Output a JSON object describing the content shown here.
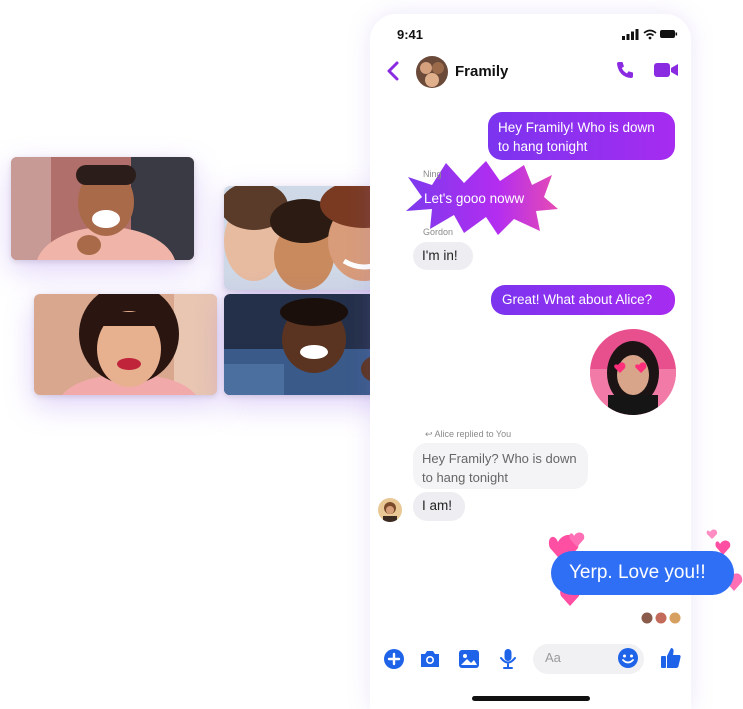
{
  "status_bar": {
    "time": "9:41"
  },
  "header": {
    "title": "Framily",
    "back_icon": "chevron-left-icon",
    "call_icon": "phone-icon",
    "video_icon": "video-camera-icon",
    "accent": "#8a2be2"
  },
  "video_call": {
    "tiles": [
      {
        "description": "participant-1"
      },
      {
        "description": "participant-2-group"
      },
      {
        "description": "participant-3"
      },
      {
        "description": "participant-4"
      }
    ]
  },
  "messages": {
    "m1": {
      "text": "Hey Framily! Who is down to hang tonight"
    },
    "m2": {
      "sender": "Ning",
      "text": "Let's gooo noww"
    },
    "m3": {
      "sender": "Gordon",
      "text": "I'm in!"
    },
    "m4": {
      "text": "Great! What about Alice?"
    },
    "reply_label": "Alice replied to You",
    "quoted": "Hey Framily? Who is down to hang tonight",
    "m5": {
      "text": "I am!"
    },
    "m6": {
      "text": "Yerp. Love you!!"
    }
  },
  "composer": {
    "placeholder": "Aa",
    "icons": [
      "plus-icon",
      "camera-icon",
      "gallery-icon",
      "microphone-icon",
      "emoji-icon",
      "thumbs-up-icon"
    ],
    "accent": "#1f63e8"
  },
  "colors": {
    "outgoing_gradient": [
      "#7b34ef",
      "#a62cf0"
    ],
    "incoming_bg": "#eeeef2",
    "love_bubble": "#2f6ff5",
    "heart": "#ff4fa3"
  }
}
